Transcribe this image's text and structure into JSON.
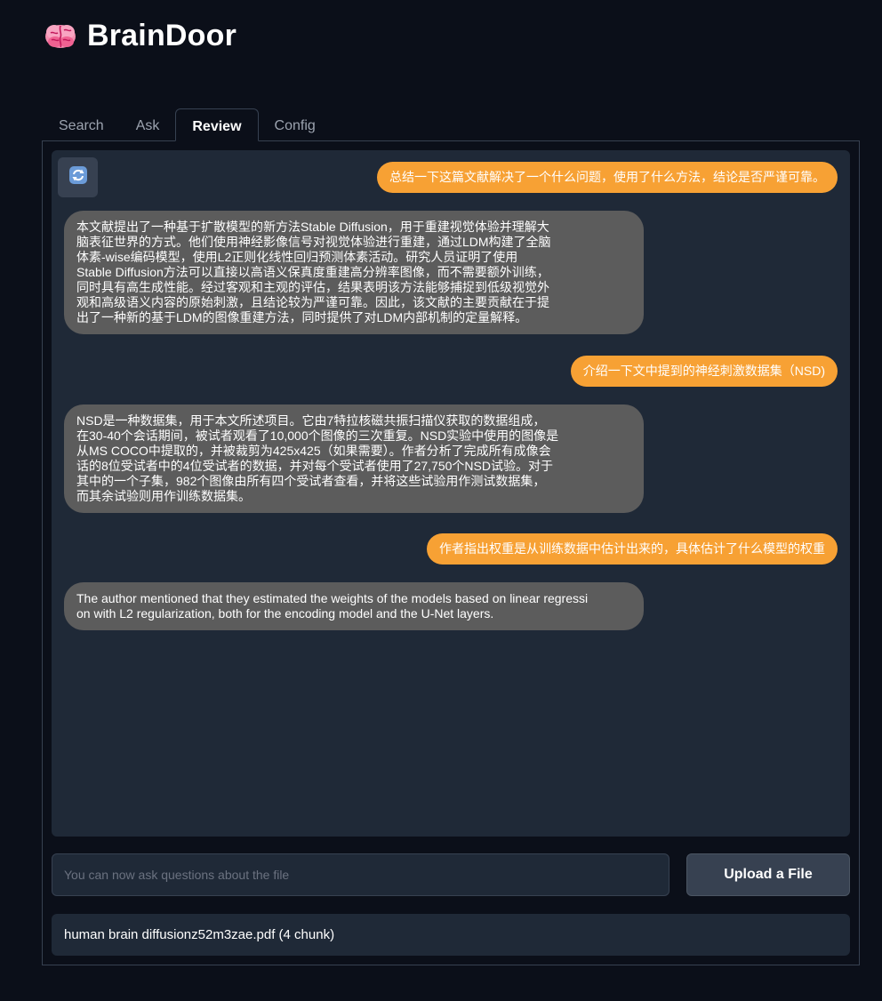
{
  "app": {
    "title": "BrainDoor",
    "logo_icon": "brain-icon"
  },
  "tabs": [
    {
      "label": "Search",
      "active": false
    },
    {
      "label": "Ask",
      "active": false
    },
    {
      "label": "Review",
      "active": true
    },
    {
      "label": "Config",
      "active": false
    }
  ],
  "chat": {
    "refresh_icon": "refresh-icon",
    "messages": [
      {
        "role": "user",
        "text": "总结一下这篇文献解决了一个什么问题，使用了什么方法，结论是否严谨可靠。"
      },
      {
        "role": "bot",
        "lines": [
          "本文献提出了一种基于扩散模型的新方法Stable Diffusion，用于重建视觉体验并理解大",
          "脑表征世界的方式。他们使用神经影像信号对视觉体验进行重建，通过LDM构建了全脑",
          "体素-wise编码模型，使用L2正则化线性回归预测体素活动。研究人员证明了使用",
          "Stable Diffusion方法可以直接以高语义保真度重建高分辨率图像，而不需要额外训练，",
          "同时具有高生成性能。经过客观和主观的评估，结果表明该方法能够捕捉到低级视觉外",
          "观和高级语义内容的原始刺激，且结论较为严谨可靠。因此，该文献的主要贡献在于提",
          "出了一种新的基于LDM的图像重建方法，同时提供了对LDM内部机制的定量解释。"
        ]
      },
      {
        "role": "user",
        "text": "介绍一下文中提到的神经刺激数据集（NSD)"
      },
      {
        "role": "bot",
        "lines": [
          "NSD是一种数据集，用于本文所述项目。它由7特拉核磁共振扫描仪获取的数据组成，",
          "在30-40个会话期间，被试者观看了10,000个图像的三次重复。NSD实验中使用的图像是",
          "从MS COCO中提取的，并被裁剪为425x425（如果需要）。作者分析了完成所有成像会",
          "话的8位受试者中的4位受试者的数据，并对每个受试者使用了27,750个NSD试验。对于",
          "其中的一个子集，982个图像由所有四个受试者查看，并将这些试验用作测试数据集，",
          "而其余试验则用作训练数据集。"
        ]
      },
      {
        "role": "user",
        "text": "作者指出权重是从训练数据中估计出来的，具体估计了什么模型的权重"
      },
      {
        "role": "bot",
        "lines": [
          "The author mentioned that they estimated the weights of the models based on linear regressi",
          "on with L2 regularization, both for the encoding model and the U-Net layers."
        ]
      }
    ]
  },
  "input": {
    "placeholder": "You can now ask questions about the file",
    "value": ""
  },
  "upload": {
    "label": "Upload a File"
  },
  "file_status": {
    "text": "human brain diffusionz52m3zae.pdf (4 chunk)"
  },
  "colors": {
    "background": "#0b0f19",
    "panel": "#1f2937",
    "user_bubble": "#f7a134",
    "bot_bubble": "#5c5c5c"
  }
}
